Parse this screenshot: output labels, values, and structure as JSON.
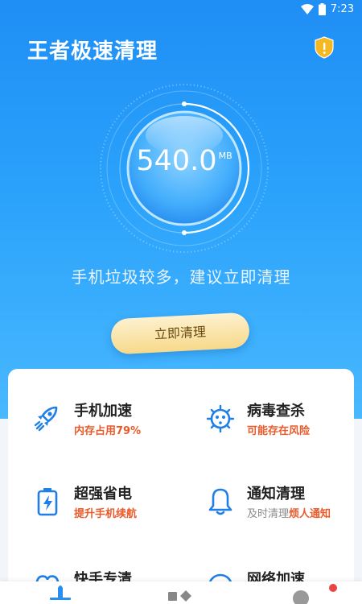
{
  "status_bar": {
    "time": "7:23",
    "icons": [
      "wifi-icon",
      "battery-icon"
    ]
  },
  "header": {
    "title": "王者极速清理",
    "icon": "shield-warning-icon"
  },
  "gauge": {
    "value": "540.0",
    "unit": "MB"
  },
  "tip": "手机垃圾较多，建议立即清理",
  "clean_button": "立即清理",
  "features": [
    {
      "title": "手机加速",
      "subtitle": "内存占用79%",
      "icon": "rocket-icon"
    },
    {
      "title": "病毒查杀",
      "subtitle": "可能存在风险",
      "icon": "virus-icon"
    },
    {
      "title": "超强省电",
      "subtitle": "提升手机续航",
      "icon": "battery-charge-icon"
    },
    {
      "title": "通知清理",
      "subtitle_gray": "及时清理",
      "subtitle_accent": "烦人通知",
      "icon": "bell-icon"
    },
    {
      "title": "快手专清",
      "icon": "heart-icon"
    },
    {
      "title": "网络加速",
      "icon": "wifi-speed-icon"
    }
  ],
  "tabs": [
    "home-tab-icon",
    "tools-tab-icon",
    "profile-tab-icon"
  ],
  "colors": {
    "accent": "#1f8ef5",
    "warning": "#ea5a2a",
    "button": "#f7d98a"
  }
}
